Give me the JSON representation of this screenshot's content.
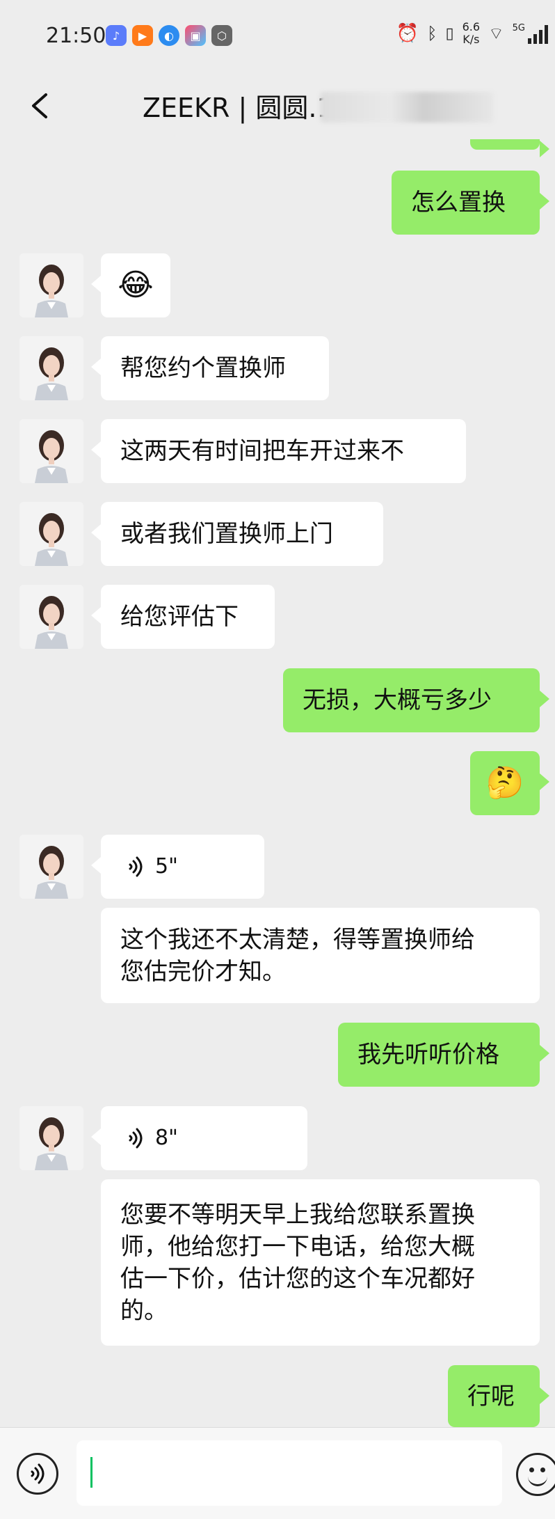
{
  "status_bar": {
    "time": "21:50",
    "net_speed_value": "6.6",
    "net_speed_unit": "K/s",
    "network_type": "5G"
  },
  "header": {
    "title": "ZEEKR | 圆圆.1",
    "back_icon": "chevron-left-icon"
  },
  "messages": [
    {
      "side": "right",
      "type": "text",
      "text": "怎么置换"
    },
    {
      "side": "left",
      "type": "emoji",
      "text": "😂"
    },
    {
      "side": "left",
      "type": "text",
      "text": "帮您约个置换师"
    },
    {
      "side": "left",
      "type": "text",
      "text": "这两天有时间把车开过来不"
    },
    {
      "side": "left",
      "type": "text",
      "text": "或者我们置换师上门"
    },
    {
      "side": "left",
      "type": "text",
      "text": "给您评估下"
    },
    {
      "side": "right",
      "type": "text",
      "text": "无损，大概亏多少"
    },
    {
      "side": "right",
      "type": "emoji",
      "text": "🤔"
    },
    {
      "side": "left",
      "type": "voice",
      "duration": "5\""
    },
    {
      "side": "left",
      "type": "transcript",
      "line1": "这个我还不太清楚，得等置换师给",
      "line2": "您估完价才知。"
    },
    {
      "side": "right",
      "type": "text",
      "text": "我先听听价格"
    },
    {
      "side": "left",
      "type": "voice",
      "duration": "8\""
    },
    {
      "side": "left",
      "type": "transcript",
      "line1": "您要不等明天早上我给您联系置换",
      "line2": "师，他给您打一下电话，给您大概",
      "line3": "估一下价，估计您的这个车况都好",
      "line4": "的。"
    },
    {
      "side": "right",
      "type": "text",
      "text": "行呢"
    }
  ],
  "input_bar": {
    "voice_icon": "voice-mode-icon",
    "emoji_icon": "emoji-face-icon",
    "input_value": ""
  },
  "colors": {
    "background": "#ededed",
    "sent_bubble": "#95ec69",
    "received_bubble": "#ffffff",
    "caret": "#07c160"
  }
}
